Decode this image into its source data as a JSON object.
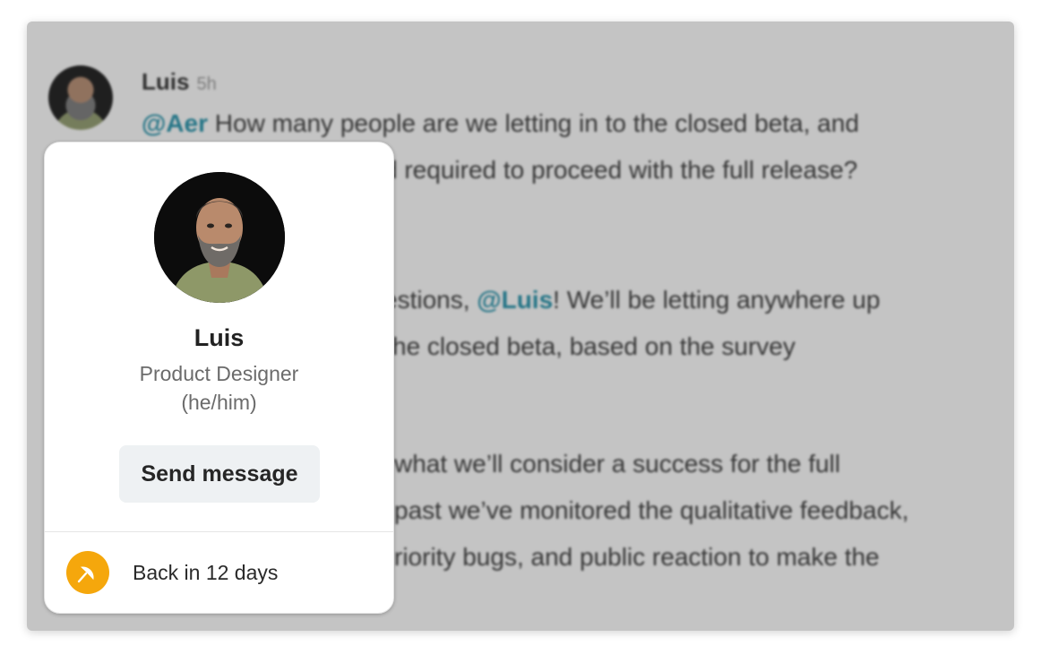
{
  "thread": {
    "author": "Luis",
    "time": "5h",
    "lines": [
      {
        "mention": "@Aer",
        "text": " How many people are we letting in to the closed beta, and"
      },
      {
        "mention": "",
        "text": "d required to proceed with the full release?"
      },
      {
        "pre": "estions, ",
        "mention": "@Luis",
        "text": "! We’ll be letting anywhere up"
      },
      {
        "mention": "",
        "text": "he closed beta, based on the survey"
      },
      {
        "mention": "",
        "text": "what we’ll consider a success for the full"
      },
      {
        "mention": "",
        "text": "past we’ve monitored the qualitative feedback,"
      },
      {
        "mention": "",
        "text": "riority bugs, and public reaction to make the"
      }
    ]
  },
  "profile": {
    "name": "Luis",
    "title": "Product Designer",
    "pronouns": "(he/him)",
    "send_label": "Send message",
    "status_icon": "umbrella-icon",
    "status_text": "Back in 12 days",
    "status_color": "#f5a70c"
  }
}
